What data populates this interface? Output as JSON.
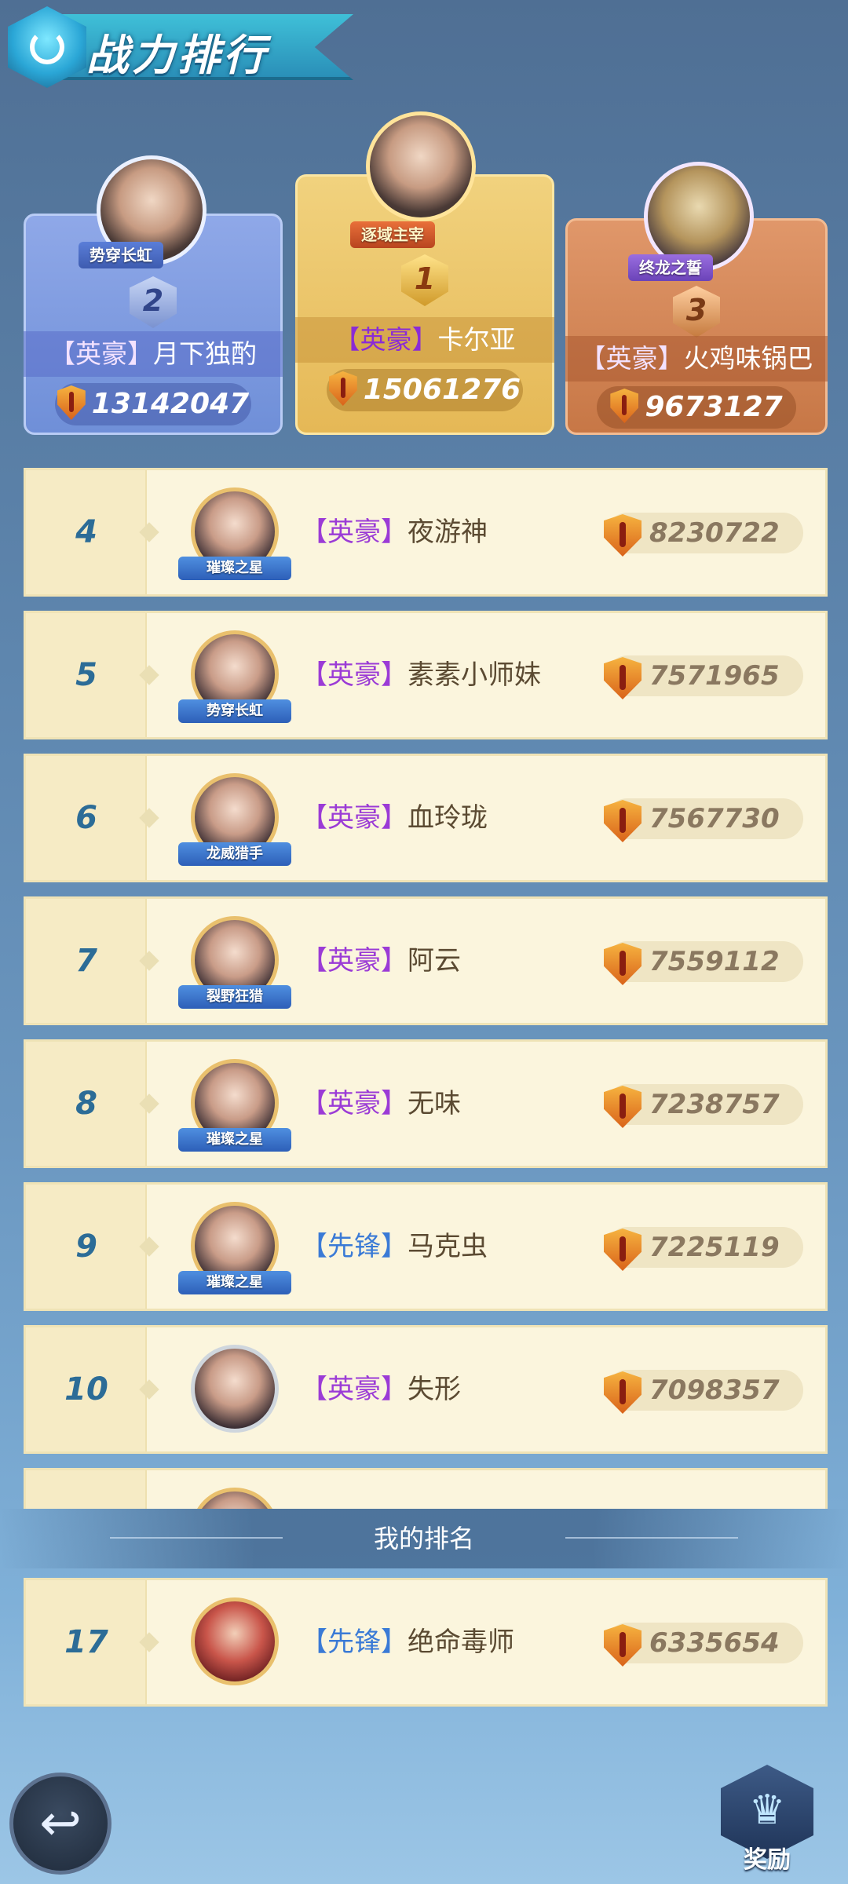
{
  "header": {
    "title": "战力排行"
  },
  "podium": [
    {
      "rank": "2",
      "title": "势穿长虹",
      "tag": "【英豪】",
      "name": "月下独酌",
      "power": "13142047"
    },
    {
      "rank": "1",
      "title": "逐域主宰",
      "tag": "【英豪】",
      "name": "卡尔亚",
      "power": "15061276"
    },
    {
      "rank": "3",
      "title": "终龙之誓",
      "tag": "【英豪】",
      "name": "火鸡味锅巴",
      "power": "9673127"
    }
  ],
  "list": [
    {
      "rank": "4",
      "title": "璀璨之星",
      "tag": "【英豪】",
      "name": "夜游神",
      "power": "8230722"
    },
    {
      "rank": "5",
      "title": "势穿长虹",
      "tag": "【英豪】",
      "name": "素素小师妹",
      "power": "7571965"
    },
    {
      "rank": "6",
      "title": "龙威猎手",
      "tag": "【英豪】",
      "name": "血玲珑",
      "power": "7567730"
    },
    {
      "rank": "7",
      "title": "裂野狂猎",
      "tag": "【英豪】",
      "name": "阿云",
      "power": "7559112"
    },
    {
      "rank": "8",
      "title": "璀璨之星",
      "tag": "【英豪】",
      "name": "无味",
      "power": "7238757"
    },
    {
      "rank": "9",
      "title": "璀璨之星",
      "tag": "【先锋】",
      "name": "马克虫",
      "power": "7225119"
    },
    {
      "rank": "10",
      "title": "",
      "tag": "【英豪】",
      "name": "失形",
      "power": "7098357"
    }
  ],
  "my_rank": {
    "label": "我的排名",
    "rank": "17",
    "tag": "【先锋】",
    "name": "绝命毒师",
    "power": "6335654"
  },
  "buttons": {
    "back_icon": "↩",
    "reward_label": "奖励",
    "reward_icon": "crown-icon"
  },
  "colors": {
    "gold_card": "#e5b856",
    "silver_card": "#6f8fd8",
    "bronze_card": "#c77746",
    "row_bg": "#fbf5dd",
    "rank_num": "#2c6c97"
  }
}
